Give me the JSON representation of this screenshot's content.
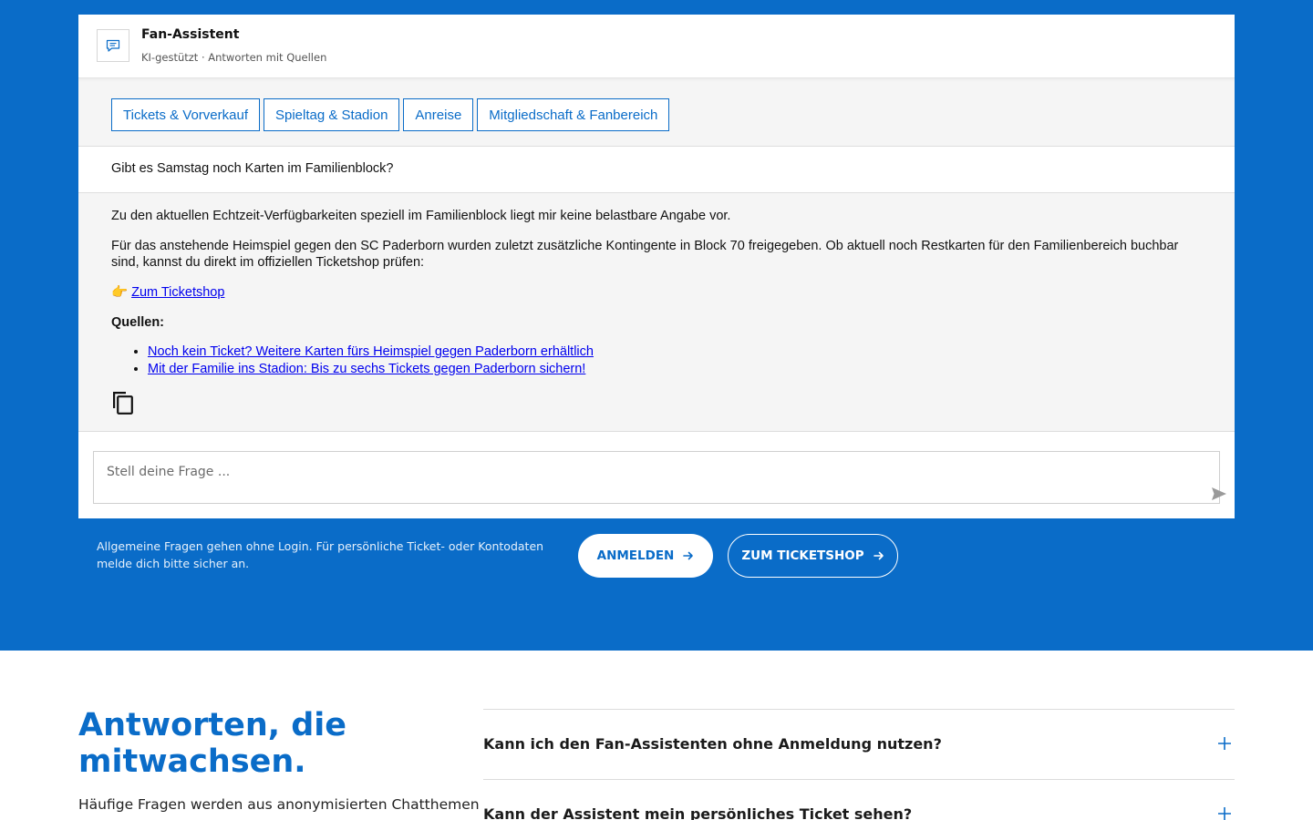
{
  "chat": {
    "title": "Fan-Assistent",
    "subtitle": "KI-gestützt · Antworten mit Quellen",
    "topics": [
      {
        "label": "Tickets & Vorverkauf"
      },
      {
        "label": "Spieltag & Stadion"
      },
      {
        "label": "Anreise"
      },
      {
        "label": "Mitgliedschaft & Fanbereich"
      }
    ],
    "user_message": "Gibt es Samstag noch Karten im Familienblock?",
    "bot_reply": {
      "paragraph_1": "Zu den aktuellen Echtzeit-Verfügbarkeiten speziell im Familienblock liegt mir keine belastbare Angabe vor.",
      "paragraph_2": "Für das anstehende Heimspiel gegen den SC Paderborn wurden zuletzt zusätzliche Kontingente in Block 70 freigegeben. Ob aktuell noch Restkarten für den Familienbereich buchbar sind, kannst du direkt im offiziellen Ticketshop prüfen:",
      "pointer_emoji": "👉",
      "ticketshop_link": "Zum Ticketshop",
      "sources_title": "Quellen:",
      "sources": [
        {
          "label": "Noch kein Ticket? Weitere Karten fürs Heimspiel gegen Paderborn erhältlich"
        },
        {
          "label": "Mit der Familie ins Stadion: Bis zu sechs Tickets gegen Paderborn sichern!"
        }
      ]
    },
    "input_placeholder": "Stell deine Frage ..."
  },
  "footer": {
    "note": "Allgemeine Fragen gehen ohne Login. Für persönliche Ticket- oder Kontodaten melde dich bitte sicher an.",
    "login_label": "ANMELDEN",
    "shop_label": "ZUM TICKETSHOP"
  },
  "faq": {
    "heading": "Antworten, die mitwachsen.",
    "intro": "Häufige Fragen werden aus anonymisierten Chatthemen",
    "items": [
      {
        "question": "Kann ich den Fan-Assistenten ohne Anmeldung nutzen?"
      },
      {
        "question": "Kann der Assistent mein persönliches Ticket sehen?"
      }
    ]
  },
  "colors": {
    "brand_blue": "#0a6cc8",
    "link_blue": "#0000ee"
  },
  "icons": {
    "header": "chat-bubble-icon",
    "copy": "copy-icon",
    "send": "send-icon",
    "arrow": "arrow-right-icon",
    "faq_toggle": "plus-icon"
  }
}
